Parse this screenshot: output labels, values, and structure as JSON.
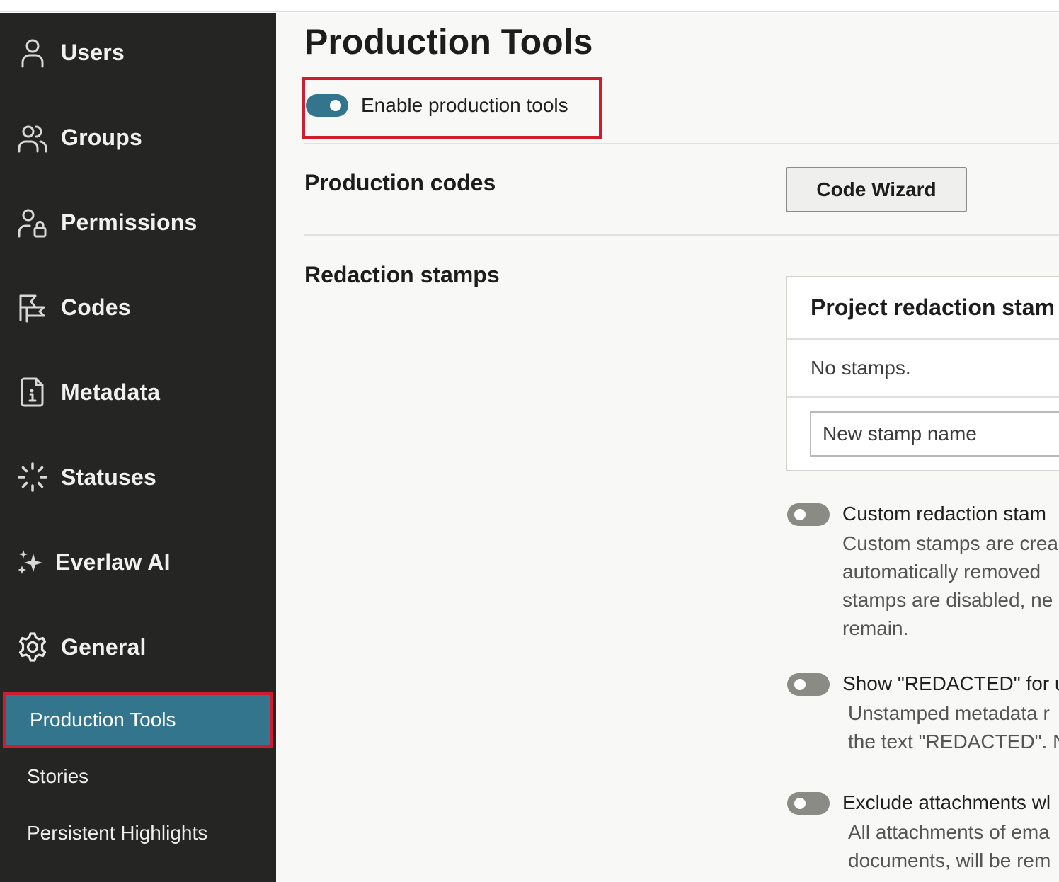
{
  "sidebar": {
    "items": [
      {
        "label": "Users",
        "icon": "user-icon"
      },
      {
        "label": "Groups",
        "icon": "users-icon"
      },
      {
        "label": "Permissions",
        "icon": "user-lock-icon"
      },
      {
        "label": "Codes",
        "icon": "codes-icon"
      },
      {
        "label": "Metadata",
        "icon": "file-info-icon"
      },
      {
        "label": "Statuses",
        "icon": "loader-icon"
      },
      {
        "label": "Everlaw AI",
        "icon": "sparkle-icon"
      },
      {
        "label": "General",
        "icon": "gear-icon"
      }
    ],
    "subitems": [
      {
        "label": "Production Tools",
        "active": true
      },
      {
        "label": "Stories",
        "active": false
      },
      {
        "label": "Persistent Highlights",
        "active": false
      }
    ]
  },
  "main": {
    "title": "Production Tools",
    "enable_toggle": {
      "label": "Enable production tools",
      "on": true
    },
    "production_codes": {
      "label": "Production codes",
      "button": "Code Wizard"
    },
    "redaction_stamps": {
      "label": "Redaction stamps",
      "panel_title": "Project redaction stam",
      "empty_text": "No stamps.",
      "input_placeholder": "New stamp name"
    },
    "options": [
      {
        "title": "Custom redaction stam",
        "on": false,
        "desc": [
          "Custom stamps are crea",
          "automatically removed",
          "stamps are disabled, ne",
          "remain."
        ]
      },
      {
        "title": "Show \"REDACTED\" for u",
        "on": false,
        "desc": [
          "Unstamped metadata r",
          "the text \"REDACTED\". N"
        ]
      },
      {
        "title": "Exclude attachments wl",
        "on": false,
        "desc": [
          "All attachments of ema",
          "documents, will be rem"
        ]
      }
    ]
  },
  "colors": {
    "sidebar_bg": "#252523",
    "accent": "#33758c",
    "highlight_border": "#cf1d2f",
    "toggle_off": "#8b8b86"
  }
}
